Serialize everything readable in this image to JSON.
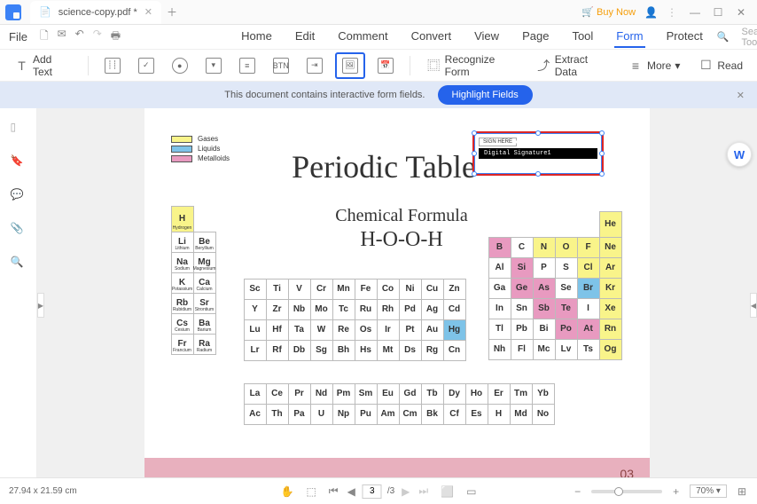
{
  "titlebar": {
    "tab_name": "science-copy.pdf *",
    "buy": "Buy Now"
  },
  "file_label": "File",
  "menu": [
    "Home",
    "Edit",
    "Comment",
    "Convert",
    "View",
    "Page",
    "Tool",
    "Form",
    "Protect"
  ],
  "menu_active_index": 7,
  "search_placeholder": "Search Tools",
  "toolbar": {
    "add_text": "Add Text",
    "recognize": "Recognize Form",
    "extract": "Extract Data",
    "more": "More",
    "read": "Read"
  },
  "infobar": {
    "msg": "This document contains interactive form fields.",
    "btn": "Highlight Fields"
  },
  "document": {
    "title": "Periodic Table",
    "subtitle": "Chemical Formula",
    "formula": "H-O-O-H",
    "legend": [
      {
        "color": "#f9f48a",
        "label": "Gases"
      },
      {
        "color": "#7ec3e8",
        "label": "Liquids"
      },
      {
        "color": "#e89ac0",
        "label": "Metalloids"
      }
    ],
    "sig_tag": "SIGN HERE",
    "sig_label": "Digital Signature1",
    "page_number": "03"
  },
  "chart_data": {
    "type": "table",
    "title": "Periodic Table",
    "blocks": {
      "left": [
        [
          {
            "s": "H",
            "c": "#f9f48a",
            "tall": true,
            "sub": "Hydrogen"
          },
          {
            "s": "",
            "empty": true
          }
        ],
        [
          {
            "s": "Li",
            "sub": "Lithium"
          },
          {
            "s": "Be",
            "sub": "Beryllium"
          }
        ],
        [
          {
            "s": "Na",
            "sub": "Sodium"
          },
          {
            "s": "Mg",
            "sub": "Magnesium"
          }
        ],
        [
          {
            "s": "K",
            "sub": "Potassium"
          },
          {
            "s": "Ca",
            "sub": "Calcium"
          }
        ],
        [
          {
            "s": "Rb",
            "sub": "Rubidium"
          },
          {
            "s": "Sr",
            "sub": "Strontium"
          }
        ],
        [
          {
            "s": "Cs",
            "sub": "Cesium"
          },
          {
            "s": "Ba",
            "sub": "Barium"
          }
        ],
        [
          {
            "s": "Fr",
            "sub": "Francium"
          },
          {
            "s": "Ra",
            "sub": "Radium"
          }
        ]
      ],
      "mid": [
        [
          {
            "s": "Sc"
          },
          {
            "s": "Ti"
          },
          {
            "s": "V"
          },
          {
            "s": "Cr"
          },
          {
            "s": "Mn"
          },
          {
            "s": "Fe"
          },
          {
            "s": "Co"
          },
          {
            "s": "Ni"
          },
          {
            "s": "Cu"
          },
          {
            "s": "Zn"
          }
        ],
        [
          {
            "s": "Y"
          },
          {
            "s": "Zr"
          },
          {
            "s": "Nb"
          },
          {
            "s": "Mo"
          },
          {
            "s": "Tc"
          },
          {
            "s": "Ru"
          },
          {
            "s": "Rh"
          },
          {
            "s": "Pd"
          },
          {
            "s": "Ag"
          },
          {
            "s": "Cd"
          }
        ],
        [
          {
            "s": "Lu"
          },
          {
            "s": "Hf"
          },
          {
            "s": "Ta"
          },
          {
            "s": "W"
          },
          {
            "s": "Re"
          },
          {
            "s": "Os"
          },
          {
            "s": "Ir"
          },
          {
            "s": "Pt"
          },
          {
            "s": "Au"
          },
          {
            "s": "Hg",
            "c": "#7ec3e8"
          }
        ],
        [
          {
            "s": "Lr"
          },
          {
            "s": "Rf"
          },
          {
            "s": "Db"
          },
          {
            "s": "Sg"
          },
          {
            "s": "Bh"
          },
          {
            "s": "Hs"
          },
          {
            "s": "Mt"
          },
          {
            "s": "Ds"
          },
          {
            "s": "Rg"
          },
          {
            "s": "Cn"
          }
        ]
      ],
      "right": [
        [
          {
            "s": "",
            "empty": true
          },
          {
            "s": "",
            "empty": true
          },
          {
            "s": "",
            "empty": true
          },
          {
            "s": "",
            "empty": true
          },
          {
            "s": "",
            "empty": true
          },
          {
            "s": "He",
            "c": "#f9f48a",
            "tall": true
          }
        ],
        [
          {
            "s": "B",
            "c": "#e89ac0"
          },
          {
            "s": "C"
          },
          {
            "s": "N",
            "c": "#f9f48a"
          },
          {
            "s": "O",
            "c": "#f9f48a"
          },
          {
            "s": "F",
            "c": "#f9f48a"
          },
          {
            "s": "Ne",
            "c": "#f9f48a"
          }
        ],
        [
          {
            "s": "Al"
          },
          {
            "s": "Si",
            "c": "#e89ac0"
          },
          {
            "s": "P"
          },
          {
            "s": "S"
          },
          {
            "s": "Cl",
            "c": "#f9f48a"
          },
          {
            "s": "Ar",
            "c": "#f9f48a"
          }
        ],
        [
          {
            "s": "Ga"
          },
          {
            "s": "Ge",
            "c": "#e89ac0"
          },
          {
            "s": "As",
            "c": "#e89ac0"
          },
          {
            "s": "Se"
          },
          {
            "s": "Br",
            "c": "#7ec3e8"
          },
          {
            "s": "Kr",
            "c": "#f9f48a"
          }
        ],
        [
          {
            "s": "In"
          },
          {
            "s": "Sn"
          },
          {
            "s": "Sb",
            "c": "#e89ac0"
          },
          {
            "s": "Te",
            "c": "#e89ac0"
          },
          {
            "s": "I"
          },
          {
            "s": "Xe",
            "c": "#f9f48a"
          }
        ],
        [
          {
            "s": "Tl"
          },
          {
            "s": "Pb"
          },
          {
            "s": "Bi"
          },
          {
            "s": "Po",
            "c": "#e89ac0"
          },
          {
            "s": "At",
            "c": "#e89ac0"
          },
          {
            "s": "Rn",
            "c": "#f9f48a"
          }
        ],
        [
          {
            "s": "Nh"
          },
          {
            "s": "Fl"
          },
          {
            "s": "Mc"
          },
          {
            "s": "Lv"
          },
          {
            "s": "Ts"
          },
          {
            "s": "Og",
            "c": "#f9f48a"
          }
        ]
      ],
      "lan": [
        [
          {
            "s": "La"
          },
          {
            "s": "Ce"
          },
          {
            "s": "Pr"
          },
          {
            "s": "Nd"
          },
          {
            "s": "Pm"
          },
          {
            "s": "Sm"
          },
          {
            "s": "Eu"
          },
          {
            "s": "Gd"
          },
          {
            "s": "Tb"
          },
          {
            "s": "Dy"
          },
          {
            "s": "Ho"
          },
          {
            "s": "Er"
          },
          {
            "s": "Tm"
          },
          {
            "s": "Yb"
          }
        ],
        [
          {
            "s": "Ac"
          },
          {
            "s": "Th"
          },
          {
            "s": "Pa"
          },
          {
            "s": "U"
          },
          {
            "s": "Np"
          },
          {
            "s": "Pu"
          },
          {
            "s": "Am"
          },
          {
            "s": "Cm"
          },
          {
            "s": "Bk"
          },
          {
            "s": "Cf"
          },
          {
            "s": "Es"
          },
          {
            "s": "H"
          },
          {
            "s": "Md"
          },
          {
            "s": "No"
          }
        ]
      ]
    }
  },
  "statusbar": {
    "dims": "27.94 x 21.59 cm",
    "page_cur": "3",
    "page_total": "/3",
    "zoom": "70%"
  }
}
